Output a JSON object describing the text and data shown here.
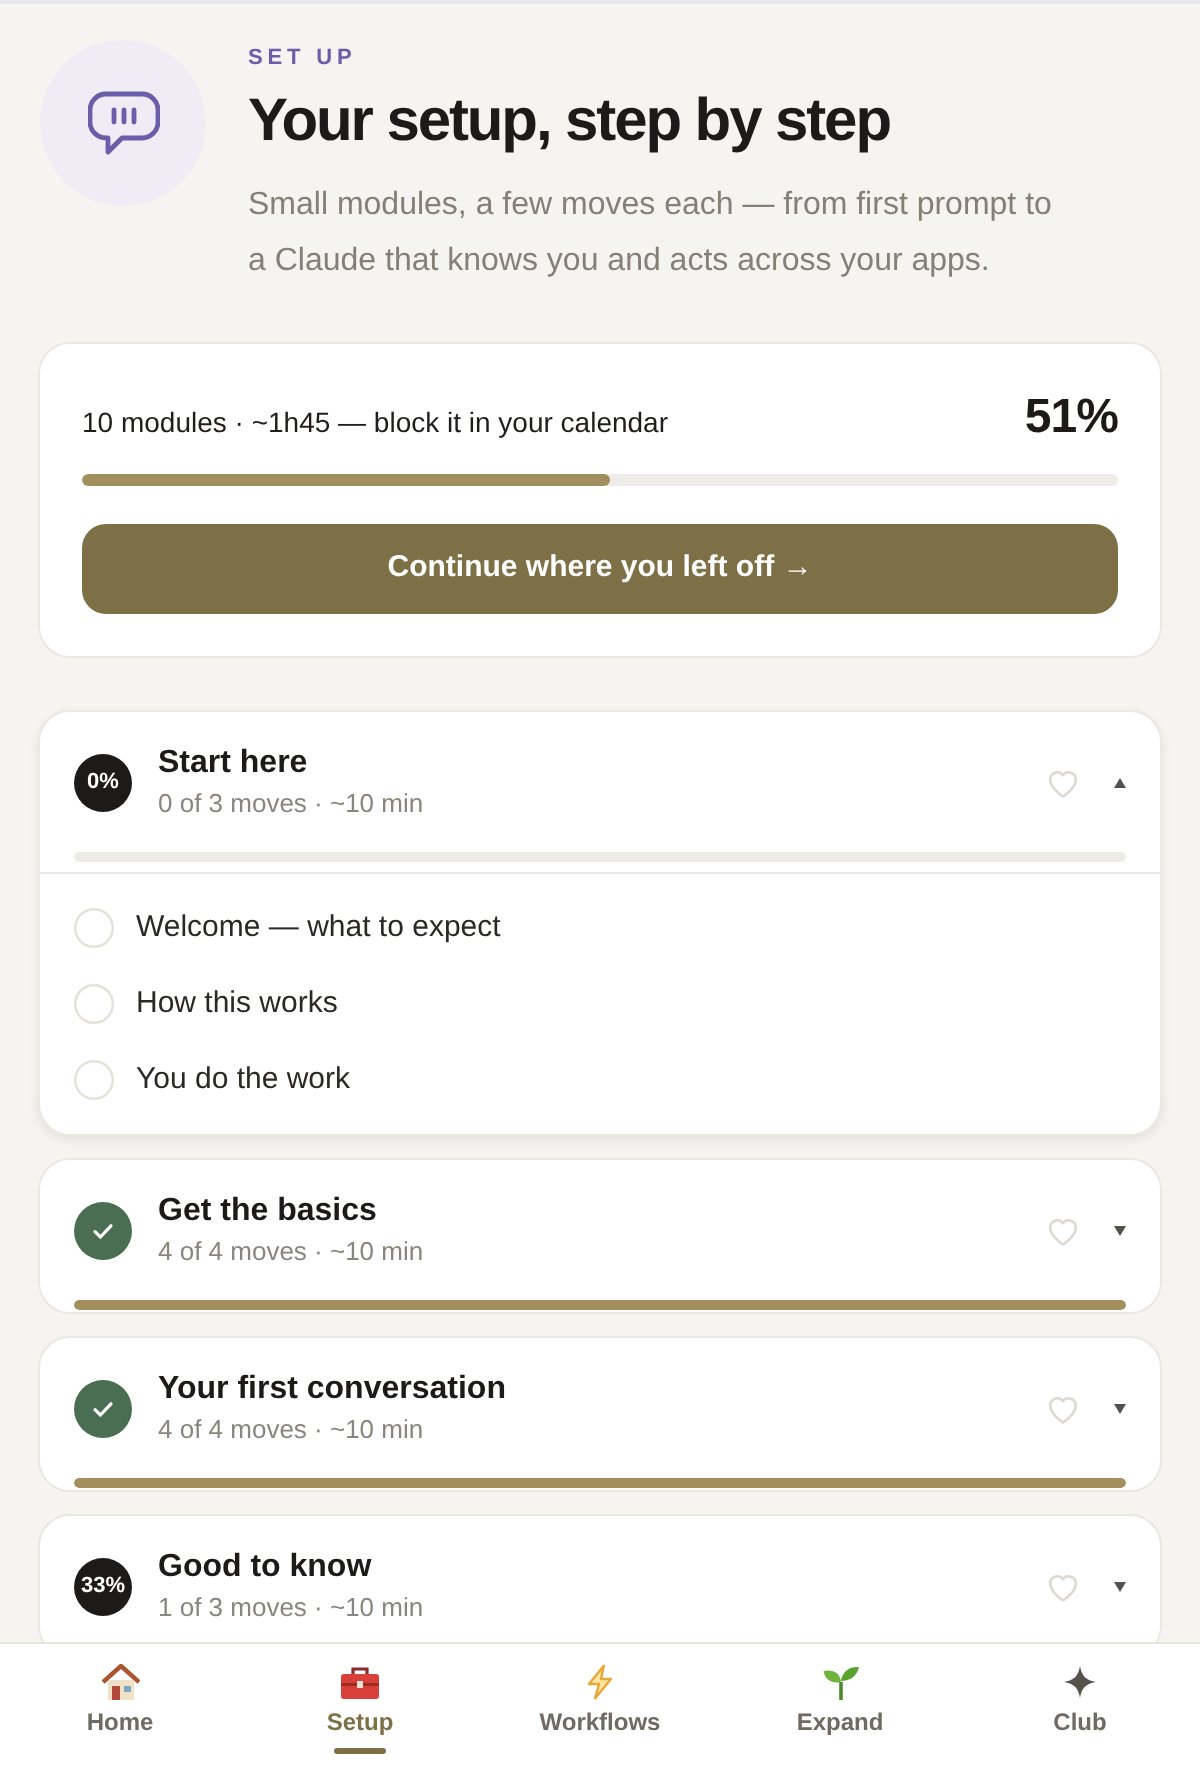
{
  "header": {
    "eyebrow": "SET UP",
    "title": "Your setup, step by step",
    "subtitle": "Small modules, a few moves each — from first prompt to a Claude that knows you and acts across your apps."
  },
  "summary": {
    "text": "10 modules · ~1h45 — block it in your calendar",
    "percent": "51%",
    "level": 0.51,
    "button": "Continue where you left off →"
  },
  "modules": [
    {
      "title": "Start here",
      "meta": "0 of 3 moves · ~10 min",
      "complete": false,
      "badge": "0%",
      "favorite": false,
      "expanded": true,
      "level": 0,
      "moves": [
        {
          "label": "Welcome — what to expect",
          "done": false
        },
        {
          "label": "How this works",
          "done": false
        },
        {
          "label": "You do the work",
          "done": false
        }
      ]
    },
    {
      "title": "Get the basics",
      "meta": "4 of 4 moves · ~10 min",
      "complete": true,
      "favorite": false,
      "expanded": false,
      "level": 1
    },
    {
      "title": "Your first conversation",
      "meta": "4 of 4 moves · ~10 min",
      "complete": true,
      "favorite": false,
      "expanded": false,
      "level": 1
    },
    {
      "title": "Good to know",
      "meta": "1 of 3 moves · ~10 min",
      "complete": false,
      "badge": "33%",
      "favorite": false,
      "expanded": false
    }
  ],
  "nav": [
    {
      "label": "Home",
      "selected": false
    },
    {
      "label": "Setup",
      "selected": true
    },
    {
      "label": "Workflows",
      "selected": false
    },
    {
      "label": "Expand",
      "selected": false
    },
    {
      "label": "Club",
      "selected": false
    }
  ]
}
